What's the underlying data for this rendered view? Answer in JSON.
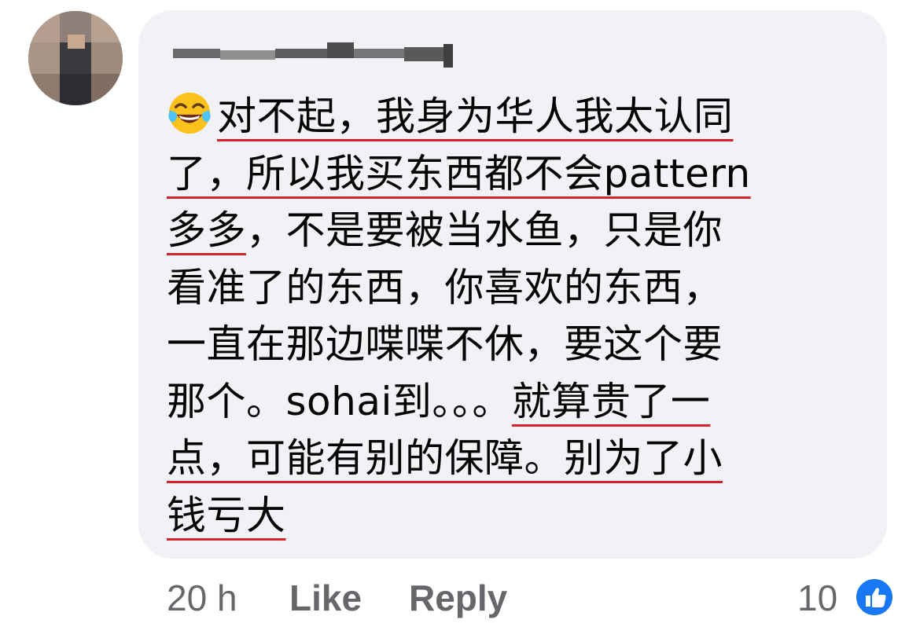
{
  "comment": {
    "author_name_visible": false,
    "emoji": "tears-of-joy-emoji",
    "lines": [
      {
        "before": "",
        "underlined": "对不起，我身为华人我太认同",
        "after": ""
      },
      {
        "before": "",
        "underlined": "了，所以我买东西都不会pattern",
        "after": ""
      },
      {
        "before": "",
        "underlined": "多多",
        "after": "，不是要被当水鱼，只是你"
      },
      {
        "before": "看准了的东西，你喜欢的东西，",
        "underlined": "",
        "after": ""
      },
      {
        "before": "一直在那边喋喋不休，要这个要",
        "underlined": "",
        "after": ""
      },
      {
        "before": "那个。sohai到。。。",
        "underlined": "就算贵了一",
        "after": ""
      },
      {
        "before": "",
        "underlined": "点，可能有别的保障。别为了小",
        "after": ""
      },
      {
        "before": "",
        "underlined": "钱亏大",
        "after": ""
      }
    ],
    "underline_color": "#d2232a"
  },
  "footer": {
    "time": "20 h",
    "like_label": "Like",
    "reply_label": "Reply"
  },
  "reactions": {
    "count": "10",
    "icon": "thumbs-up-icon",
    "color": "#1877f2"
  }
}
